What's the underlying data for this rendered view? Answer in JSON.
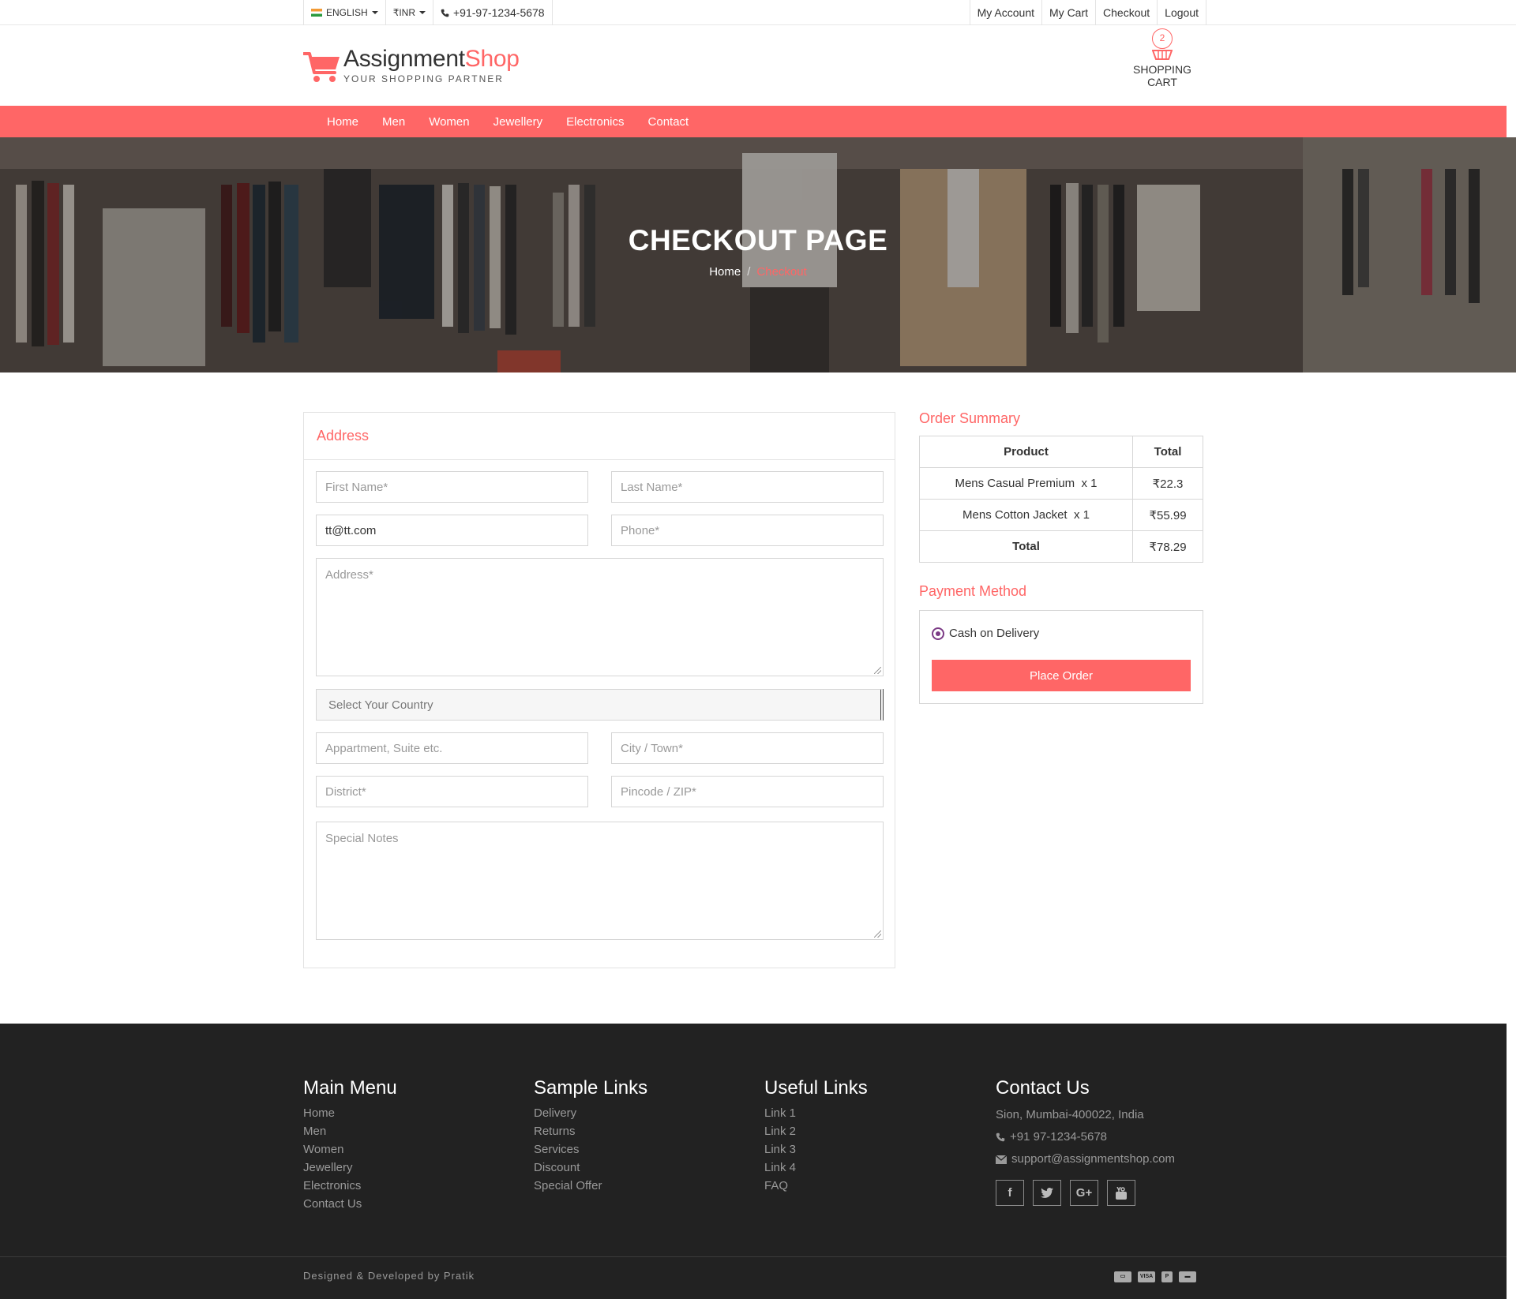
{
  "topbar": {
    "language": "ENGLISH",
    "currency": "INR",
    "currency_symbol": "₹",
    "phone": "+91-97-1234-5678",
    "links": [
      "My Account",
      "My Cart",
      "Checkout",
      "Logout"
    ]
  },
  "brand": {
    "name_main": "Assignment",
    "name_accent": "Shop",
    "tagline": "YOUR SHOPPING PARTNER",
    "accent_color": "#ff6666"
  },
  "cart": {
    "count": "2",
    "label": "SHOPPING CART"
  },
  "nav": {
    "items": [
      "Home",
      "Men",
      "Women",
      "Jewellery",
      "Electronics",
      "Contact"
    ]
  },
  "banner": {
    "title": "CHECKOUT PAGE",
    "breadcrumb_home": "Home",
    "breadcrumb_sep": "/",
    "breadcrumb_current": "Checkout"
  },
  "address_form": {
    "title": "Address",
    "first_name_placeholder": "First Name*",
    "last_name_placeholder": "Last Name*",
    "email_value": "tt@tt.com",
    "phone_placeholder": "Phone*",
    "address_placeholder": "Address*",
    "country_selected": "Select Your Country",
    "apartment_placeholder": "Appartment, Suite etc.",
    "city_placeholder": "City / Town*",
    "district_placeholder": "District*",
    "pincode_placeholder": "Pincode / ZIP*",
    "notes_placeholder": "Special Notes"
  },
  "order_summary": {
    "title": "Order Summary",
    "headers": [
      "Product",
      "Total"
    ],
    "rows": [
      {
        "product": "Mens Casual Premium",
        "qty": "x 1",
        "total": "₹22.3"
      },
      {
        "product": "Mens Cotton Jacket",
        "qty": "x 1",
        "total": "₹55.99"
      }
    ],
    "total_label": "Total",
    "total_value": "₹78.29"
  },
  "payment": {
    "title": "Payment Method",
    "option": "Cash on Delivery",
    "button": "Place Order"
  },
  "footer": {
    "main_menu": {
      "title": "Main Menu",
      "links": [
        "Home",
        "Men",
        "Women",
        "Jewellery",
        "Electronics",
        "Contact Us"
      ]
    },
    "sample_links": {
      "title": "Sample Links",
      "links": [
        "Delivery",
        "Returns",
        "Services",
        "Discount",
        "Special Offer"
      ]
    },
    "useful_links": {
      "title": "Useful Links",
      "links": [
        "Link 1",
        "Link 2",
        "Link 3",
        "Link 4",
        "FAQ"
      ]
    },
    "contact": {
      "title": "Contact Us",
      "address": "Sion, Mumbai-400022, India",
      "phone": "+91 97-1234-5678",
      "email": "support@assignmentshop.com"
    },
    "social_icons": [
      "facebook-icon",
      "twitter-icon",
      "google-plus-icon",
      "youtube-icon"
    ],
    "credit": "Designed & Developed by Pratik",
    "payment_icons": [
      "card-icon",
      "visa-icon",
      "paypal-icon",
      "discover-icon"
    ]
  }
}
